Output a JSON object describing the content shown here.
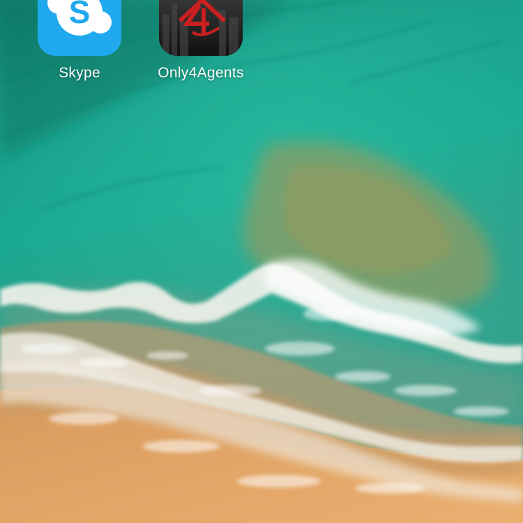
{
  "home_screen": {
    "apps": [
      {
        "label": "Skype",
        "icon": "skype-icon",
        "color": "#20a9ee"
      },
      {
        "label": "Only4Agents",
        "icon": "only4agents-house-icon",
        "color": "#cc1f1f"
      }
    ]
  },
  "wallpaper": {
    "description_colors": {
      "deep_water": "#14806f",
      "mid_water": "#1fae96",
      "sand_water": "#8e9d6a",
      "foam": "#f2f1ea",
      "sand": "#e3a664"
    }
  }
}
